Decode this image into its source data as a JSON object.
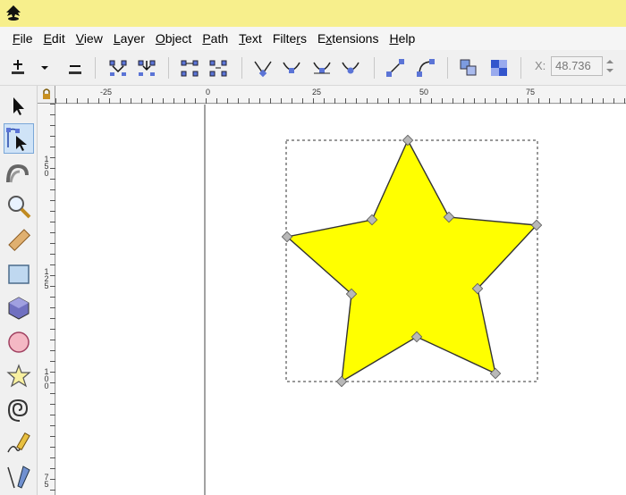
{
  "menu": [
    {
      "label": "File",
      "accel": "F"
    },
    {
      "label": "Edit",
      "accel": "E"
    },
    {
      "label": "View",
      "accel": "V"
    },
    {
      "label": "Layer",
      "accel": "L"
    },
    {
      "label": "Object",
      "accel": "O"
    },
    {
      "label": "Path",
      "accel": "P"
    },
    {
      "label": "Text",
      "accel": "T"
    },
    {
      "label": "Filters",
      "accel": "r"
    },
    {
      "label": "Extensions",
      "accel": "x"
    },
    {
      "label": "Help",
      "accel": "H"
    }
  ],
  "toolbar": {
    "x_label": "X:",
    "x_value": "48.736"
  },
  "hruler": {
    "labels": [
      "-25",
      "0",
      "25",
      "50",
      "75"
    ]
  },
  "vruler": {
    "labels": [
      "1\n5\n0",
      "1\n2\n5",
      "1\n0\n0",
      "7\n5"
    ]
  },
  "colors": {
    "title_bar": "#f7ef8c",
    "star_fill": "#ffff00",
    "star_stroke": "#333333",
    "node": "#b8b8b8"
  },
  "tools": [
    "selector-tool",
    "node-tool",
    "tweak-tool",
    "zoom-tool",
    "measure-tool",
    "rectangle-tool",
    "3d-box-tool",
    "ellipse-tool",
    "star-tool",
    "spiral-tool",
    "pencil-tool",
    "pen-tool"
  ]
}
